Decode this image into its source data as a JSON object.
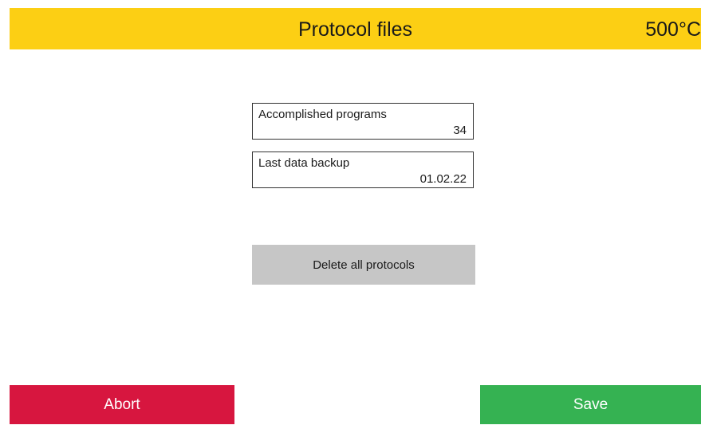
{
  "header": {
    "title": "Protocol files",
    "temperature": "500°C"
  },
  "info": {
    "programs": {
      "label": "Accomplished programs",
      "value": "34"
    },
    "backup": {
      "label": "Last data backup",
      "value": "01.02.22"
    }
  },
  "actions": {
    "delete_label": "Delete all protocols",
    "abort_label": "Abort",
    "save_label": "Save"
  },
  "colors": {
    "header_bg": "#fccf14",
    "delete_bg": "#c6c6c6",
    "abort_bg": "#d7163f",
    "save_bg": "#35b252"
  }
}
